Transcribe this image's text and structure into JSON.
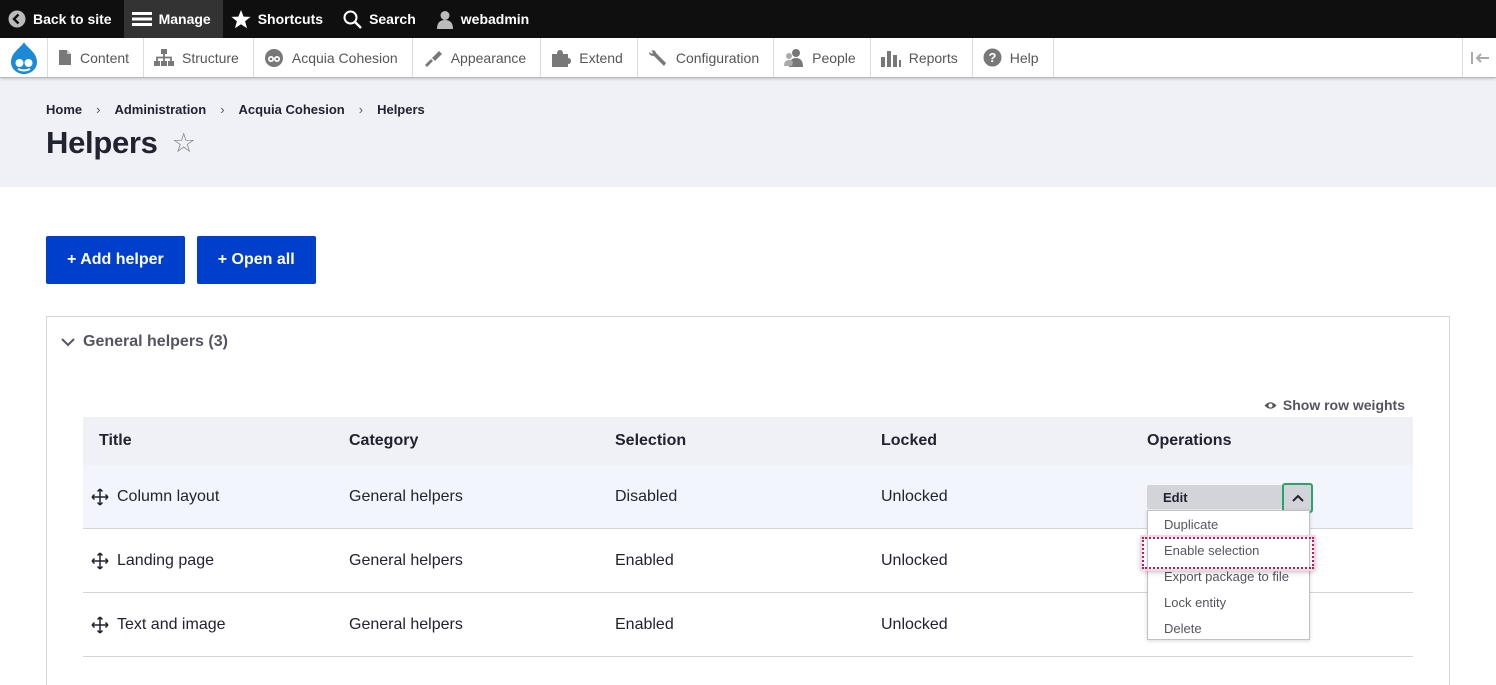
{
  "toolbar": {
    "back_to_site": "Back to site",
    "manage": "Manage",
    "shortcuts": "Shortcuts",
    "search": "Search",
    "user": "webadmin"
  },
  "tray": {
    "items": [
      "Content",
      "Structure",
      "Acquia Cohesion",
      "Appearance",
      "Extend",
      "Configuration",
      "People",
      "Reports",
      "Help"
    ]
  },
  "breadcrumb": [
    "Home",
    "Administration",
    "Acquia Cohesion",
    "Helpers"
  ],
  "breadcrumb_separator": "›",
  "page": {
    "title": "Helpers",
    "star": "☆"
  },
  "actions": {
    "add_helper": "+ Add helper",
    "open_all": "+ Open all"
  },
  "group": {
    "summary": "General helpers (3)",
    "show_row_weights": "Show row weights"
  },
  "table": {
    "headers": [
      "Title",
      "Category",
      "Selection",
      "Locked",
      "Operations"
    ],
    "rows": [
      {
        "title": "Column layout",
        "category": "General helpers",
        "selection": "Disabled",
        "locked": "Unlocked"
      },
      {
        "title": "Landing page",
        "category": "General helpers",
        "selection": "Enabled",
        "locked": "Unlocked"
      },
      {
        "title": "Text and image",
        "category": "General helpers",
        "selection": "Enabled",
        "locked": "Unlocked"
      }
    ]
  },
  "dropbutton": {
    "main": "Edit",
    "items": [
      "Duplicate",
      "Enable selection",
      "Export package to file",
      "Lock entity",
      "Delete"
    ]
  },
  "colors": {
    "primary_button": "#003ecc",
    "toolbar_bg": "#0f0f0f",
    "header_bg": "#eff1f6",
    "focus_ring": "#26a769",
    "highlight_outline": "#c2185b"
  }
}
